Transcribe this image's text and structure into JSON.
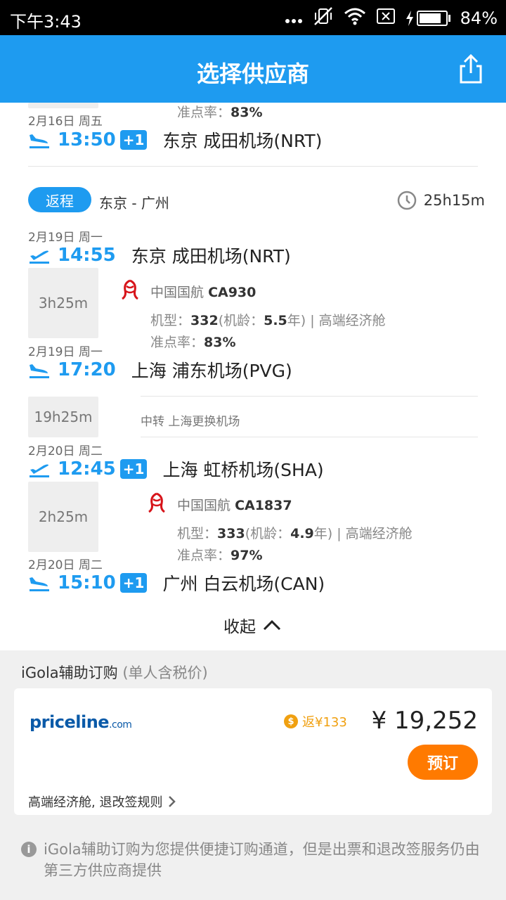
{
  "status_bar": {
    "time": "下午3:43",
    "battery_pct_text": "84%",
    "battery_level": 0.84
  },
  "header": {
    "title": "选择供应商"
  },
  "outbound_tail": {
    "ontime_label": "准点率：",
    "ontime_value": "83%",
    "arr_date": "2月16日 周五",
    "arr_time": "13:50",
    "arr_day_offset": "+1",
    "arr_airport": "东京 成田机场(NRT)"
  },
  "return_trip": {
    "tag": "返程",
    "route": "东京 - 广州",
    "total_duration": "25h15m",
    "seg1": {
      "dep_date": "2月19日 周一",
      "dep_time": "14:55",
      "dep_airport": "东京 成田机场(NRT)",
      "duration": "3h25m",
      "airline": "中国国航",
      "flight_no": "CA930",
      "aircraft_label": "机型：",
      "aircraft": "332",
      "age_label": "(机龄：",
      "age": "5.5",
      "age_suffix": "年) | 高端经济舱",
      "ontime_label": "准点率：",
      "ontime": "83%",
      "arr_date": "2月19日 周一",
      "arr_time": "17:20",
      "arr_airport": "上海 浦东机场(PVG)"
    },
    "transfer": {
      "duration": "19h25m",
      "text": "中转  上海更换机场"
    },
    "seg2": {
      "dep_date": "2月20日 周二",
      "dep_time": "12:45",
      "dep_day_offset": "+1",
      "dep_airport": "上海 虹桥机场(SHA)",
      "duration": "2h25m",
      "airline": "中国国航",
      "flight_no": "CA1837",
      "aircraft_label": "机型：",
      "aircraft": "333",
      "age_label": "(机龄：",
      "age": "4.9",
      "age_suffix": "年) | 高端经济舱",
      "ontime_label": "准点率：",
      "ontime": "97%",
      "arr_date": "2月20日 周二",
      "arr_time": "15:10",
      "arr_day_offset": "+1",
      "arr_airport": "广州 白云机场(CAN)"
    }
  },
  "collapse_label": "收起",
  "booking": {
    "section_title": "iGola辅助订购",
    "section_note": "(单人含税价)",
    "vendor_main": "priceline",
    "vendor_dotcom": ".com",
    "cashback": "返¥133",
    "price": "¥ 19,252",
    "book_label": "预订",
    "cabin_rule": "高端经济舱, 退改签规则",
    "notice": "iGola辅助订购为您提供便捷订购通道，但是出票和退改签服务仍由第三方供应商提供"
  },
  "colors": {
    "primary": "#1e9bf0",
    "accent": "#ff7a00",
    "cashback": "#f0a010",
    "airline_red": "#d7141a"
  }
}
